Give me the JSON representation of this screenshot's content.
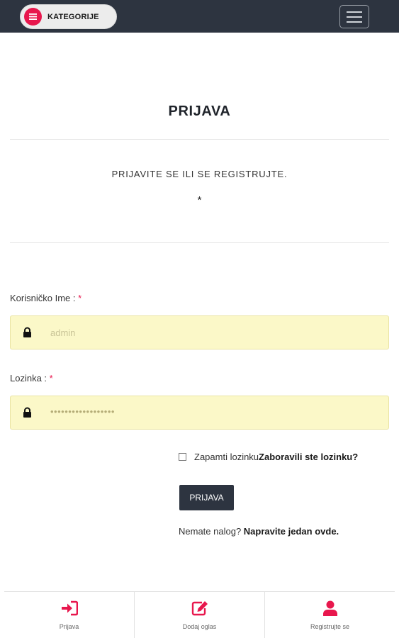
{
  "header": {
    "categories_label": "KATEGORIJE",
    "menu_icon": "hamburger-icon",
    "categories_icon": "list-icon"
  },
  "main": {
    "title": "PRIJAVA",
    "subtitle": "PRIJAVITE SE ILI SE REGISTRUJTE.",
    "asterisk": "*"
  },
  "form": {
    "username_label": "Korisničko Ime : ",
    "username_required": "*",
    "username_placeholder": "admin",
    "password_label": "Lozinka : ",
    "password_required": "*",
    "password_value": "••••••••••••••••••",
    "remember_label": "Zapamti lozinku",
    "forgot_link": "Zaboravili ste lozinku?",
    "submit_label": "PRIJAVA",
    "no_account_text": "Nemate nalog? ",
    "register_link": "Napravite jedan ovde."
  },
  "bottom_nav": {
    "items": [
      {
        "label": "Prijava",
        "icon": "sign-in-icon"
      },
      {
        "label": "Dodaj oglas",
        "icon": "edit-icon"
      },
      {
        "label": "Registrujte se",
        "icon": "user-icon"
      }
    ]
  },
  "colors": {
    "accent": "#e8174d",
    "dark": "#2d3440",
    "input_bg": "#fbf8c8"
  }
}
